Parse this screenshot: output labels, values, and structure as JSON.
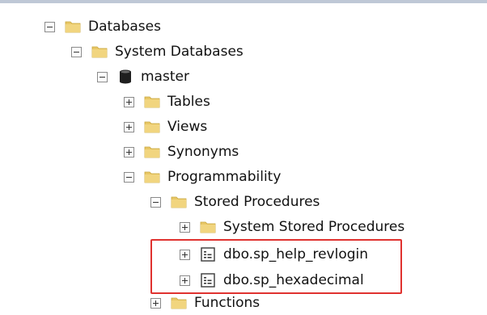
{
  "tree": {
    "databases": {
      "label": "Databases",
      "icon": "folder-icon",
      "state": "expanded"
    },
    "system_databases": {
      "label": "System Databases",
      "icon": "folder-icon",
      "state": "expanded"
    },
    "master": {
      "label": "master",
      "icon": "database-icon",
      "state": "expanded"
    },
    "tables": {
      "label": "Tables",
      "icon": "folder-icon",
      "state": "collapsed"
    },
    "views": {
      "label": "Views",
      "icon": "folder-icon",
      "state": "collapsed"
    },
    "synonyms": {
      "label": "Synonyms",
      "icon": "folder-icon",
      "state": "collapsed"
    },
    "programmability": {
      "label": "Programmability",
      "icon": "folder-icon",
      "state": "expanded"
    },
    "stored_procedures": {
      "label": "Stored Procedures",
      "icon": "folder-icon",
      "state": "expanded"
    },
    "system_stored_procedures": {
      "label": "System Stored Procedures",
      "icon": "folder-icon",
      "state": "collapsed"
    },
    "sp_help_revlogin": {
      "label": "dbo.sp_help_revlogin",
      "icon": "stored-procedure-icon",
      "state": "collapsed"
    },
    "sp_hexadecimal": {
      "label": "dbo.sp_hexadecimal",
      "icon": "stored-procedure-icon",
      "state": "collapsed"
    },
    "functions": {
      "label": "Functions",
      "icon": "folder-icon",
      "state": "collapsed"
    }
  },
  "colors": {
    "folder": "#e8c766",
    "highlight": "#e0322f",
    "database": "#1f1f1f"
  }
}
